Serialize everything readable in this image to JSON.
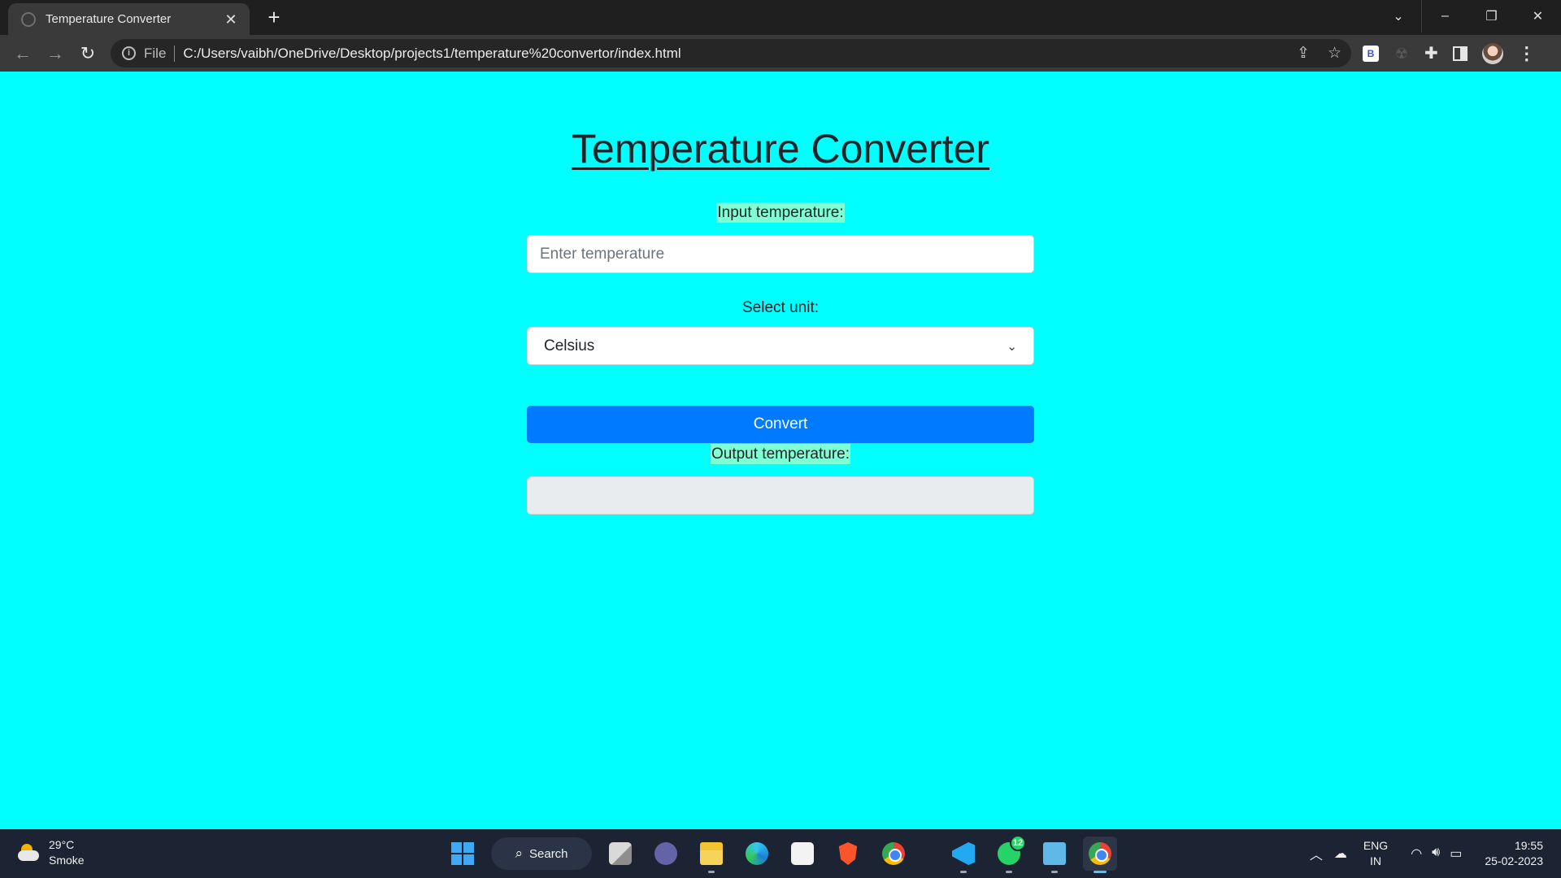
{
  "browser": {
    "tab_title": "Temperature Converter",
    "scheme_label": "File",
    "url": "C:/Users/vaibh/OneDrive/Desktop/projects1/temperature%20convertor/index.html",
    "extension_label": "B"
  },
  "page": {
    "title": "Temperature Converter",
    "input_label": "Input temperature:",
    "input_placeholder": "Enter temperature",
    "unit_label": "Select unit:",
    "unit_selected": "Celsius",
    "convert_label": "Convert",
    "output_label": "Output temperature:",
    "output_value": ""
  },
  "colors": {
    "page_background": "#00ffff",
    "label_highlight": "#7fffd4",
    "button_primary": "#007bff",
    "output_background": "#e9ecef"
  },
  "taskbar": {
    "weather_temp": "29°C",
    "weather_desc": "Smoke",
    "search_label": "Search",
    "whatsapp_badge": "12",
    "lang_line1": "ENG",
    "lang_line2": "IN",
    "time": "19:55",
    "date": "25-02-2023"
  }
}
